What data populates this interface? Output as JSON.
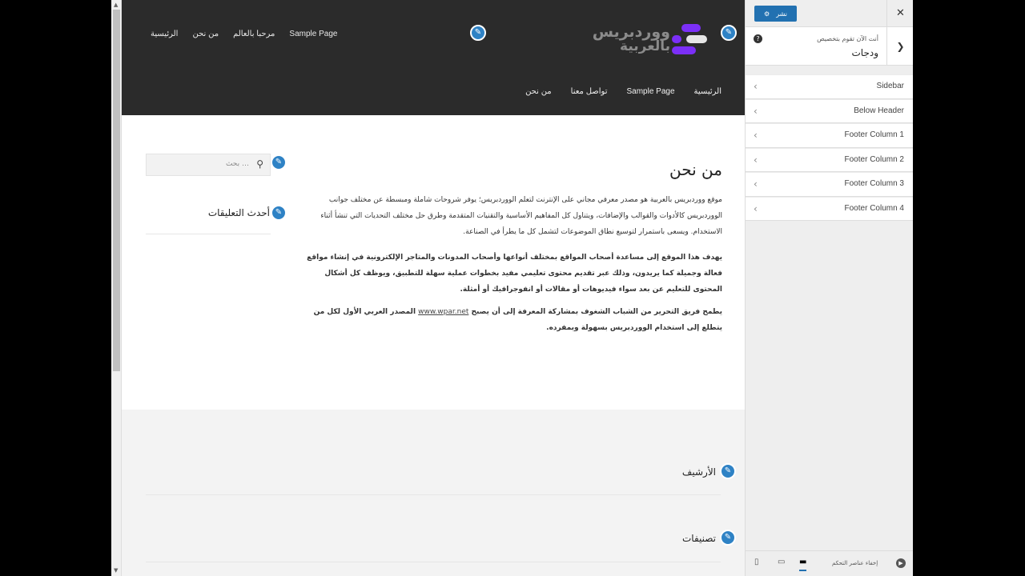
{
  "header": {
    "top_nav": [
      "الرئيسية",
      "من نحن",
      "مرحبا بالعالم",
      "Sample Page"
    ],
    "main_nav": [
      "الرئيسية",
      "Sample Page",
      "تواصل معنا",
      "من نحن"
    ],
    "logo_line1": "ووردبريس",
    "logo_line2": "بالعربية"
  },
  "content": {
    "page_title": "من نحن",
    "para1": "موقع ووردبريس بالعربية هو مصدر معرفي مجاني على الإنترنت لتعلم الووردبريس؛ يوفر شروحات شاملة ومبسطة عن مختلف جوانب الووردبريس كالأدوات والقوالب والإضافات، ويتناول كل المفاهيم الأساسية والتقنيات المتقدمة وطرق حل مختلف التحديات التي تنشأ أثناء الاستخدام. ويسعى باستمرار لتوسيع نطاق الموضوعات لتشمل كل ما يطرأ في الصناعة.",
    "para2": "يهدف هذا الموقع إلى مساعدة أصحاب المواقع بمختلف أنواعها وأصحاب المدونات والمتاجر الإلكترونية في إنشاء مواقع فعالة وجميلة كما يريدون، وذلك عبر تقديم محتوى تعليمي مفيد بخطوات عملية سهلة للتطبيق، ويوظف كل أشكال المحتوى للتعليم عن بعد سواء فيديوهات أو مقالات أو انفوجرافيك أو أمثلة.",
    "para3_before": "يطمح فريق التحرير من الشباب الشغوف بمشاركة المعرفة إلى أن يصبح ",
    "para3_link": "www.wpar.net",
    "para3_after": " المصدر العربي الأول لكل من يتطلع إلى استخدام الووردبريس بسهولة وبمفرده."
  },
  "sidebar": {
    "search_placeholder": "بحث …",
    "recent_comments": "أحدث التعليقات"
  },
  "footer_widgets": {
    "archives": "الأرشيف",
    "categories": "تصنيفات"
  },
  "customizer": {
    "publish_label": "نشر",
    "section_subtitle": "أنت الآن تقوم بتخصيص",
    "section_title": "ودجات",
    "widget_areas": [
      "Sidebar",
      "Below Header",
      "Footer Column 1",
      "Footer Column 2",
      "Footer Column 3",
      "Footer Column 4"
    ],
    "collapse_label": "إخفاء عناصر التحكم"
  },
  "colors": {
    "header_bg": "#2b2b2b",
    "accent": "#2271b1",
    "logo_purple": "#7b2ff7"
  }
}
